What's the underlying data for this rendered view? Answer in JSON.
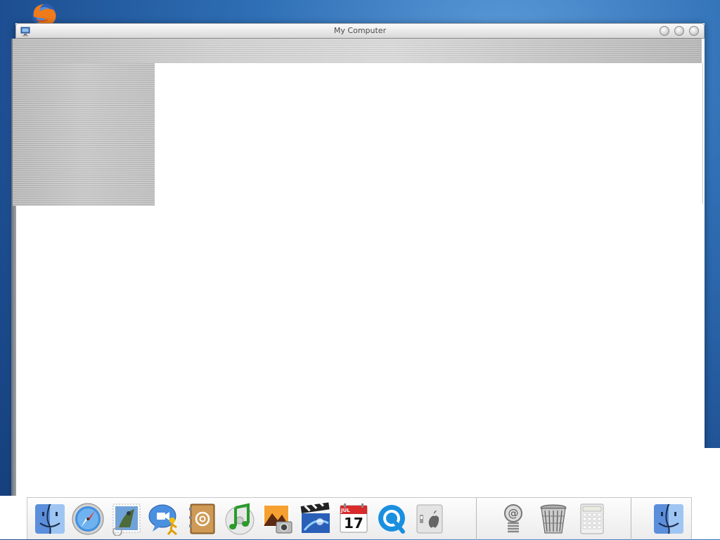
{
  "window": {
    "title": "My Computer"
  },
  "desktop": {
    "icons": [
      {
        "name": "firefox-icon"
      }
    ]
  },
  "dock": {
    "items": [
      {
        "name": "finder-icon"
      },
      {
        "name": "safari-icon"
      },
      {
        "name": "mail-icon"
      },
      {
        "name": "ichat-icon"
      },
      {
        "name": "address-book-icon"
      },
      {
        "name": "itunes-icon"
      },
      {
        "name": "iphoto-icon"
      },
      {
        "name": "imovie-icon"
      },
      {
        "name": "ical-icon"
      },
      {
        "name": "quicktime-icon"
      },
      {
        "name": "system-preferences-icon"
      },
      {
        "name": "internet-connect-icon"
      },
      {
        "name": "trash-icon"
      },
      {
        "name": "calculator-icon"
      },
      {
        "name": "finder-right-icon"
      }
    ],
    "ical": {
      "month": "JUL",
      "day": "17"
    }
  }
}
